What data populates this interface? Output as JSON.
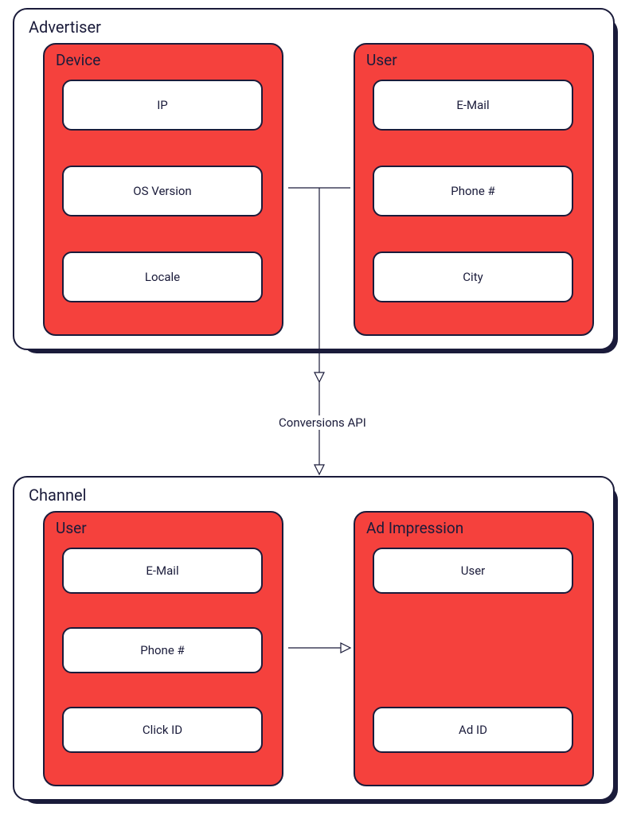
{
  "advertiser": {
    "label": "Advertiser",
    "device": {
      "label": "Device",
      "items": [
        "IP",
        "OS Version",
        "Locale"
      ]
    },
    "user": {
      "label": "User",
      "items": [
        "E-Mail",
        "Phone #",
        "City"
      ]
    }
  },
  "api_label": "Conversions API",
  "channel": {
    "label": "Channel",
    "user": {
      "label": "User",
      "items": [
        "E-Mail",
        "Phone #",
        "Click ID"
      ]
    },
    "adimpression": {
      "label": "Ad Impression",
      "items": [
        "User",
        "Ad ID"
      ]
    }
  }
}
